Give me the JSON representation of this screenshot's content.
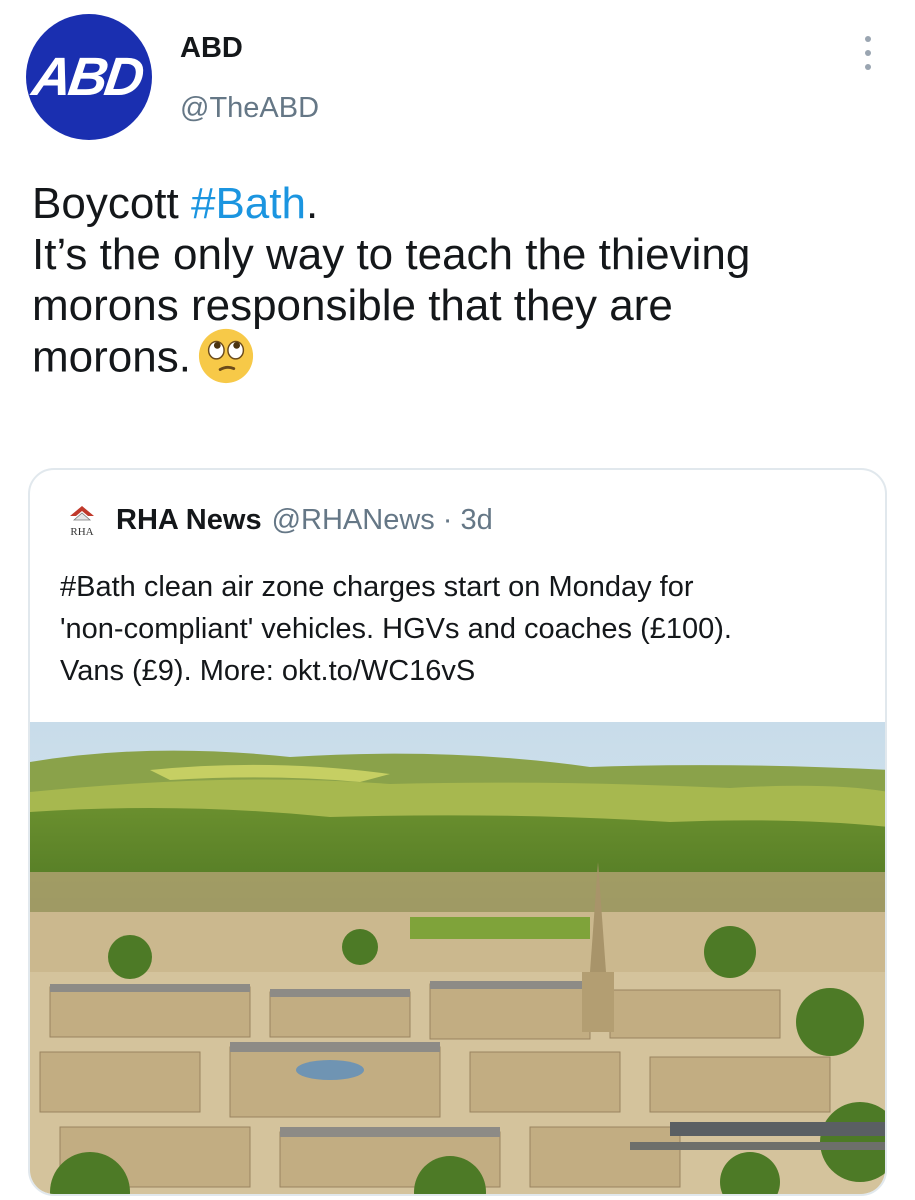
{
  "author": {
    "display_name": "ABD",
    "handle": "@TheABD",
    "avatar_text": "ABD",
    "avatar_color": "#1a2fb0"
  },
  "tweet": {
    "line1_prefix": "Boycott ",
    "hashtag": "#Bath",
    "line1_suffix": ".",
    "line2": "It’s the only way to teach the thieving",
    "line3": "morons responsible that they are",
    "line4": "morons.",
    "emoji": "face-with-rolling-eyes"
  },
  "quoted_tweet": {
    "logo_text": "RHA",
    "display_name": "RHA News",
    "handle": "@RHANews",
    "separator": "·",
    "time": "3d",
    "text_lines": [
      "#Bath clean air zone charges start on Monday for",
      "'non-compliant' vehicles. HGVs and coaches (£100).",
      "Vans (£9). More: okt.to/WC16vS"
    ],
    "image_icon": "city-of-bath-landscape-photo"
  },
  "colors": {
    "link": "#1b95e0",
    "secondary_text": "#657786",
    "border": "#e1e8ed"
  }
}
